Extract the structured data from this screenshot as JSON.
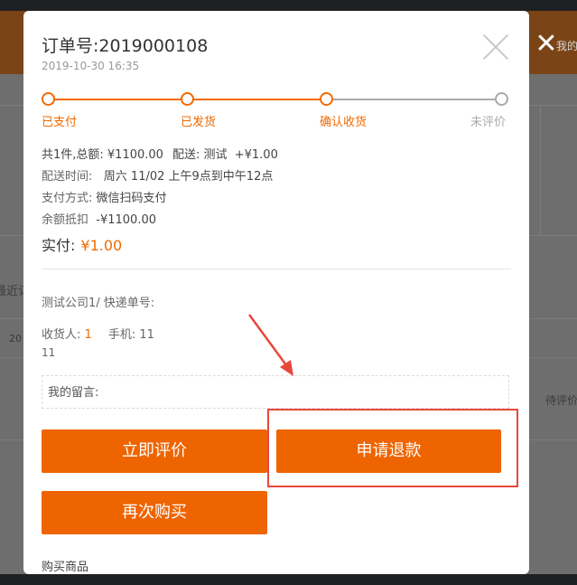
{
  "background": {
    "header_text": "我的",
    "left_text_1": "最近订",
    "left_text_2": "20",
    "right_text": "待评价"
  },
  "modal": {
    "order_title": "订单号:2019000108",
    "order_date": "2019-10-30 16:35",
    "close_icon": "close-icon",
    "steps": [
      {
        "label": "已支付",
        "done": true
      },
      {
        "label": "已发货",
        "done": true
      },
      {
        "label": "确认收货",
        "done": true
      },
      {
        "label": "未评价",
        "done": false
      }
    ],
    "summary": {
      "count_total": "共1件,总额: ¥1100.00",
      "shipping_label": "配送: 测试",
      "shipping_fee": "+¥1.00"
    },
    "delivery_time": {
      "label": "配送时间:",
      "value": "周六 11/02 上午9点到中午12点"
    },
    "payment_method": {
      "label": "支付方式:",
      "value": "微信扫码支付"
    },
    "balance_deduct": {
      "label": "余额抵扣",
      "value": "-¥1100.00"
    },
    "paid": {
      "label": "实付:",
      "value": "¥1.00"
    },
    "company_line": "测试公司1/ 快递单号:",
    "receiver": {
      "label": "收货人:",
      "value": "1",
      "phone_label": "手机:",
      "phone_part1": "11",
      "phone_part2": "11"
    },
    "message_label": "我的留言:",
    "buttons": {
      "review": "立即评价",
      "refund": "申请退款",
      "rebuy": "再次购买"
    },
    "section_title": "购买商品"
  },
  "colors": {
    "accent": "#ee6400",
    "highlight": "#e8473b",
    "pending": "#aaaaaa"
  }
}
